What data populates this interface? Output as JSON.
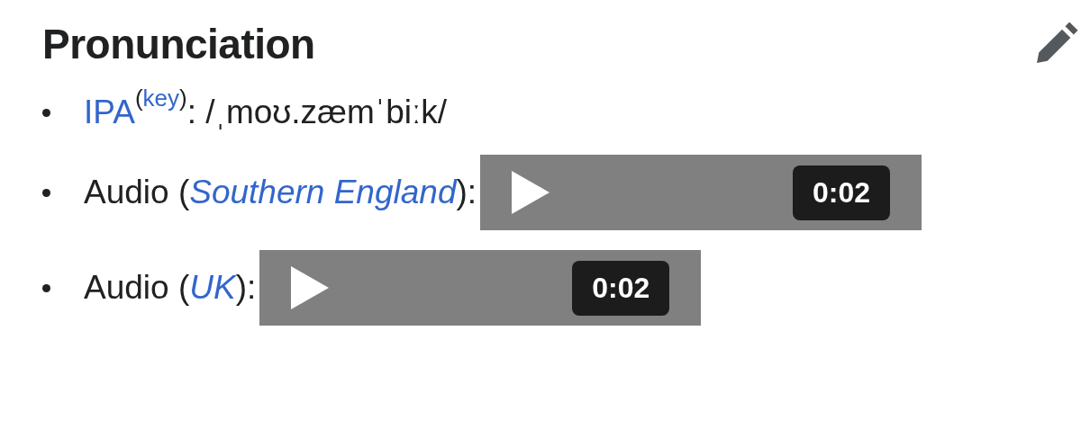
{
  "heading": "Pronunciation",
  "items": [
    {
      "segments": [
        {
          "kind": "link",
          "text": "IPA"
        },
        {
          "kind": "sup-text",
          "text": "("
        },
        {
          "kind": "sup-link",
          "text": "key"
        },
        {
          "kind": "sup-text",
          "text": ")"
        },
        {
          "kind": "text",
          "text": ": /ˌmoʊ.zæmˈbiːk/"
        }
      ]
    },
    {
      "segments": [
        {
          "kind": "text",
          "text": "Audio ("
        },
        {
          "kind": "italic-link",
          "text": "Southern England"
        },
        {
          "kind": "text",
          "text": "):"
        },
        {
          "kind": "player",
          "duration": "0:02"
        }
      ]
    },
    {
      "segments": [
        {
          "kind": "text",
          "text": "Audio ("
        },
        {
          "kind": "italic-link",
          "text": "UK"
        },
        {
          "kind": "text",
          "text": "):"
        },
        {
          "kind": "player",
          "duration": "0:02"
        }
      ]
    }
  ]
}
